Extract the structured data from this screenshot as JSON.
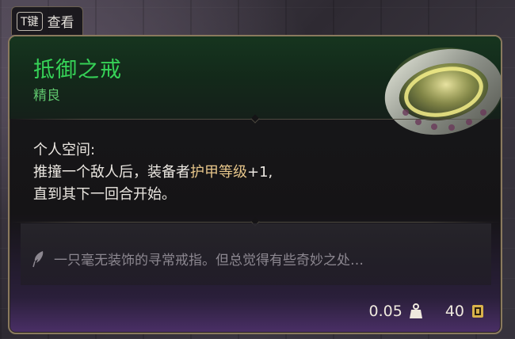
{
  "key_hint": {
    "key": "T键",
    "label": "查看"
  },
  "item": {
    "name": "抵御之戒",
    "rarity": "精良",
    "effect_title": "个人空间:",
    "effect_line1_a": "推撞一个敌人后，装备者",
    "effect_line1_hl": "护甲等级",
    "effect_line1_b": "+1,",
    "effect_line2": "直到其下一回合开始。",
    "flavor": "一只毫无装饰的寻常戒指。但总觉得有些奇妙之处…",
    "weight": "0.05",
    "value": "40"
  },
  "colors": {
    "name": "#36d257",
    "rarity": "#5fc56d",
    "highlight": "#e6c58a",
    "flavor": "#8c8790",
    "border": "#8a7a5e"
  },
  "icons": {
    "item": "ring-icon",
    "flavor": "quill-icon",
    "weight": "weight-icon",
    "value": "gold-coin-icon"
  }
}
